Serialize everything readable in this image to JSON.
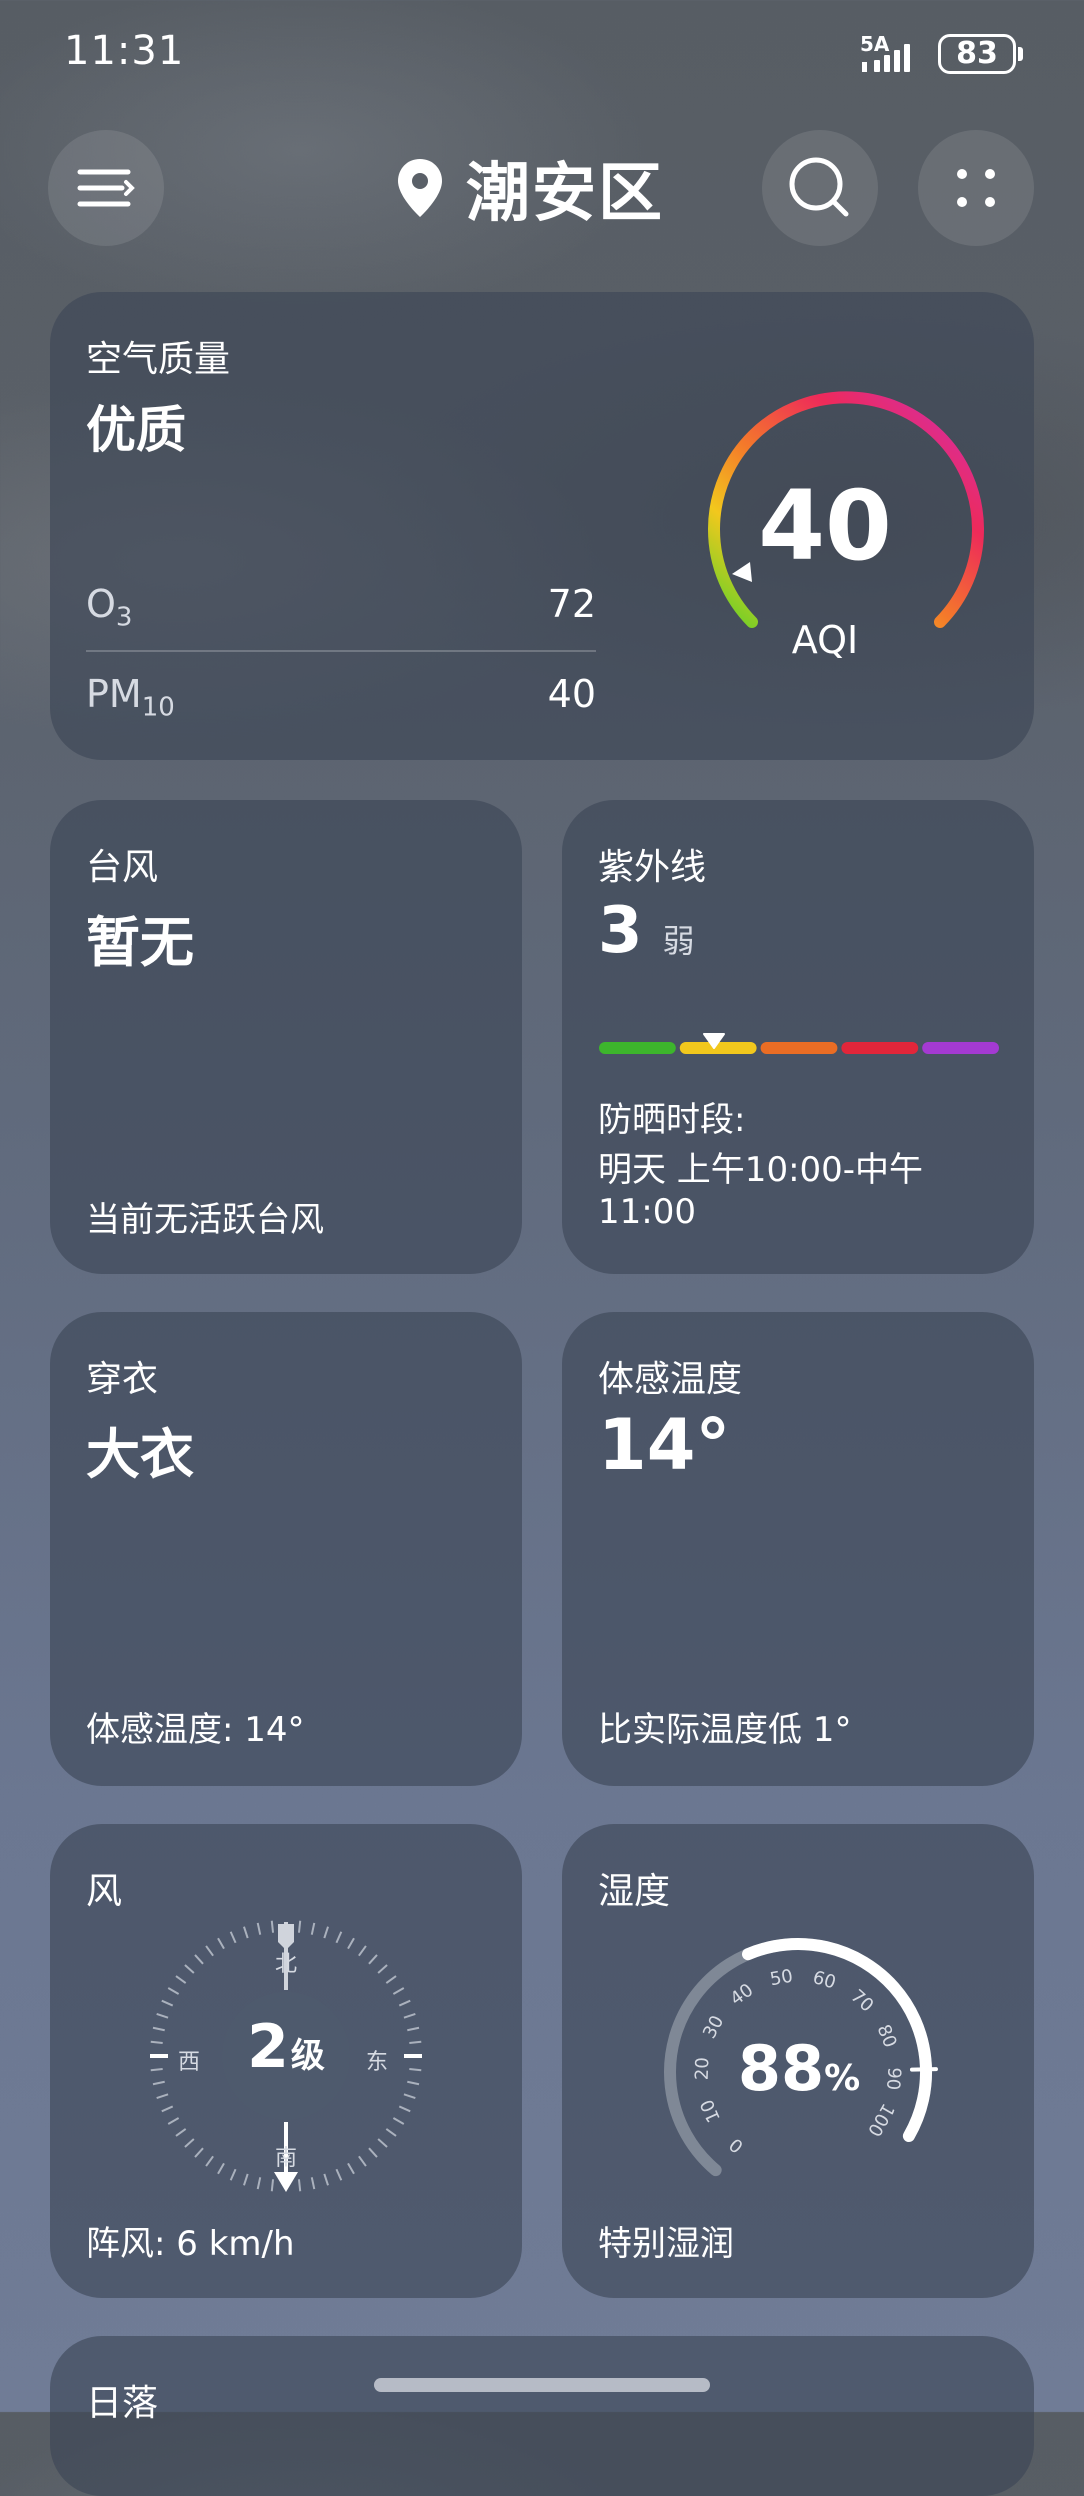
{
  "status_bar": {
    "time": "11:31",
    "network": "5A",
    "battery": "83"
  },
  "header": {
    "location": "潮安区"
  },
  "air_quality": {
    "label": "空气质量",
    "level": "优质",
    "value": "40",
    "unit": "AQI",
    "pollutants": [
      {
        "name": "O",
        "sub": "3",
        "value": "72"
      },
      {
        "name": "PM",
        "sub": "10",
        "value": "40"
      }
    ]
  },
  "typhoon": {
    "label": "台风",
    "value": "暂无",
    "footnote": "当前无活跃台风"
  },
  "uv": {
    "label": "紫外线",
    "value": "3",
    "level": "弱",
    "scale_colors": [
      "#3db52c",
      "#f2c81d",
      "#ea6d24",
      "#e2263a",
      "#a43ad2"
    ],
    "protection_label": "防晒时段:",
    "protection_line1": "明天 上午10:00-中午",
    "protection_line2": "11:00"
  },
  "clothing": {
    "label": "穿衣",
    "value": "大衣",
    "footnote": "体感温度:  14°"
  },
  "feels_like": {
    "label": "体感温度",
    "value": "14°",
    "footnote": "比实际温度低 1°"
  },
  "wind": {
    "label": "风",
    "level_num": "2",
    "level_unit": "级",
    "dir_n": "北",
    "dir_s": "南",
    "dir_e": "东",
    "dir_w": "西",
    "gust": "阵风:  6 km/h"
  },
  "humidity": {
    "label": "湿度",
    "value": "88",
    "unit": "%",
    "value_fraction": 0.88,
    "ticks": [
      "0",
      "10",
      "20",
      "30",
      "40",
      "50",
      "60",
      "70",
      "80",
      "90",
      "100"
    ],
    "footnote": "特别湿润"
  },
  "sunset": {
    "label": "日落"
  }
}
